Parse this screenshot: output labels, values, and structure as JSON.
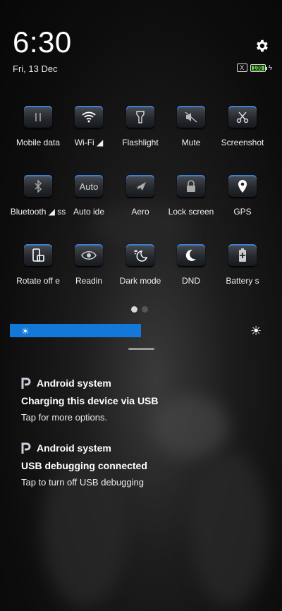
{
  "status": {
    "time": "6:30",
    "date": "Fri, 13 Dec",
    "battery_level": "100",
    "sim": "X"
  },
  "tiles": [
    {
      "label": "Mobile data",
      "icon": "mobile-data-icon"
    },
    {
      "label": "Wi-Fi ◢",
      "icon": "wifi-icon"
    },
    {
      "label": "Flashlight",
      "icon": "flashlight-icon"
    },
    {
      "label": "Mute",
      "icon": "mute-icon"
    },
    {
      "label": "Screenshot",
      "icon": "scissors-icon"
    },
    {
      "label": "Bluetooth ◢ ss",
      "icon": "bluetooth-icon"
    },
    {
      "label": "Auto ide",
      "icon": "auto-text-icon",
      "icon_text": "Auto"
    },
    {
      "label": "Aero",
      "icon": "airplane-icon"
    },
    {
      "label": "Lock screen",
      "icon": "lock-icon"
    },
    {
      "label": "GPS",
      "icon": "location-pin-icon"
    },
    {
      "label": "Rotate off e",
      "icon": "rotate-icon"
    },
    {
      "label": "Readin",
      "icon": "eye-icon"
    },
    {
      "label": "Dark mode",
      "icon": "dark-mode-icon"
    },
    {
      "label": "DND",
      "icon": "moon-icon"
    },
    {
      "label": "Battery s",
      "icon": "battery-saver-icon"
    }
  ],
  "pager": {
    "page": 1,
    "pages": 2
  },
  "brightness": {
    "level": 0.49,
    "color": "#1478d8"
  },
  "notifications": [
    {
      "app": "Android system",
      "title": "Charging this device via USB",
      "text": "Tap for more options."
    },
    {
      "app": "Android system",
      "title": "USB debugging connected",
      "text": "Tap to turn off USB debugging"
    }
  ]
}
